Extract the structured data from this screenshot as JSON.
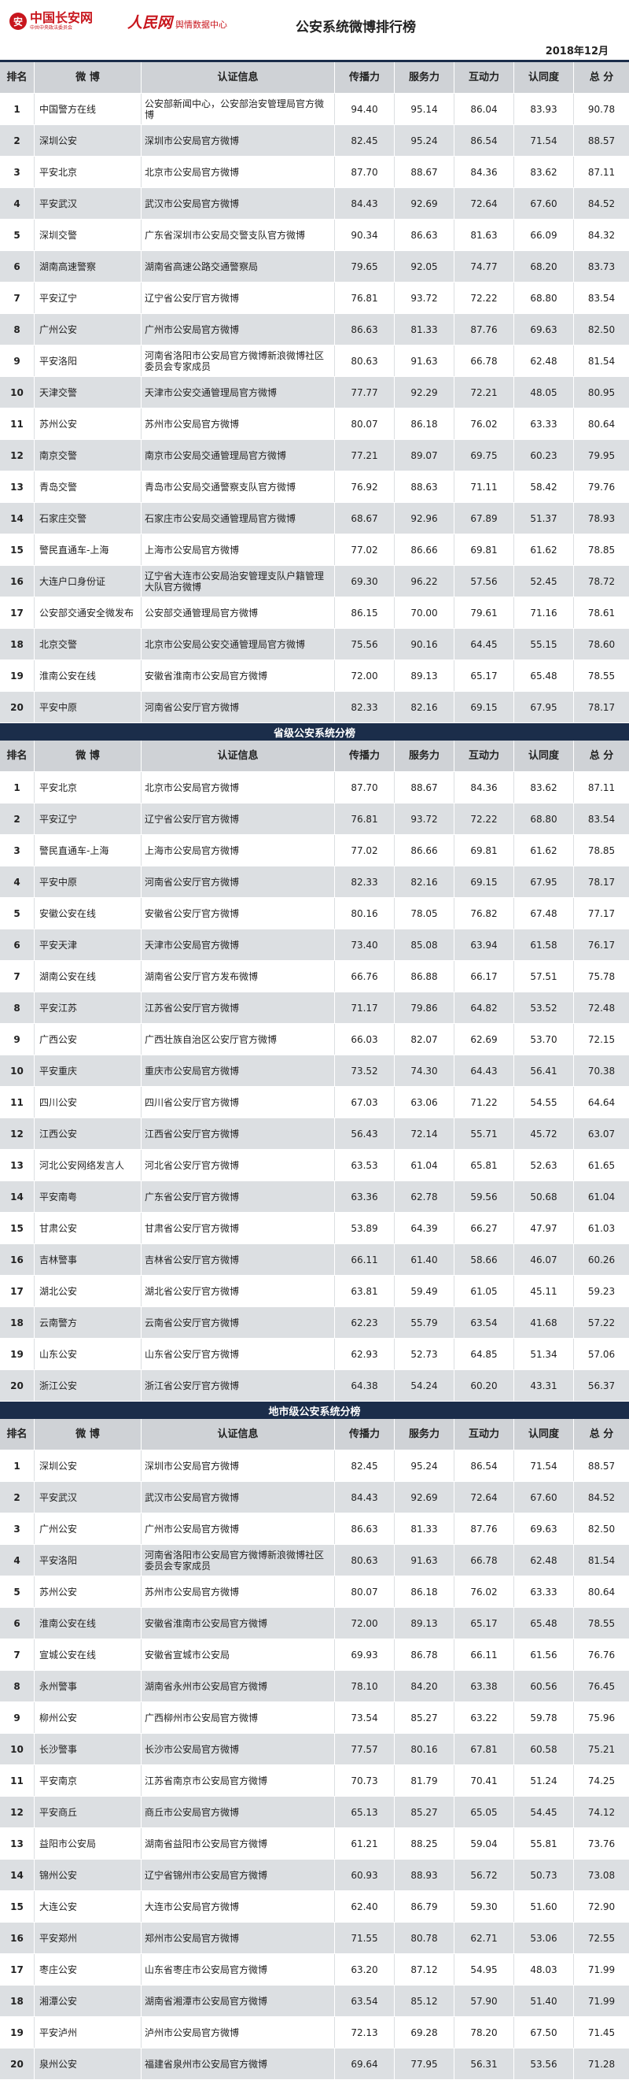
{
  "logos": {
    "site_name": "中国长安网",
    "site_sub": "中共中央政法委员会",
    "brand": "人民网",
    "brand_center": "舆情数据中心"
  },
  "title": "公安系统微博排行榜",
  "date": "2018年12月",
  "columns": [
    "排名",
    "微 博",
    "认证信息",
    "传播力",
    "服务力",
    "互动力",
    "认同度",
    "总 分"
  ],
  "sections": [
    {
      "title": "",
      "rows": [
        [
          "1",
          "中国警方在线",
          "公安部新闻中心，公安部治安管理局官方微博",
          "94.40",
          "95.14",
          "86.04",
          "83.93",
          "90.78"
        ],
        [
          "2",
          "深圳公安",
          "深圳市公安局官方微博",
          "82.45",
          "95.24",
          "86.54",
          "71.54",
          "88.57"
        ],
        [
          "3",
          "平安北京",
          "北京市公安局官方微博",
          "87.70",
          "88.67",
          "84.36",
          "83.62",
          "87.11"
        ],
        [
          "4",
          "平安武汉",
          "武汉市公安局官方微博",
          "84.43",
          "92.69",
          "72.64",
          "67.60",
          "84.52"
        ],
        [
          "5",
          "深圳交警",
          "广东省深圳市公安局交警支队官方微博",
          "90.34",
          "86.63",
          "81.63",
          "66.09",
          "84.32"
        ],
        [
          "6",
          "湖南高速警察",
          "湖南省高速公路交通警察局",
          "79.65",
          "92.05",
          "74.77",
          "68.20",
          "83.73"
        ],
        [
          "7",
          "平安辽宁",
          "辽宁省公安厅官方微博",
          "76.81",
          "93.72",
          "72.22",
          "68.80",
          "83.54"
        ],
        [
          "8",
          "广州公安",
          "广州市公安局官方微博",
          "86.63",
          "81.33",
          "87.76",
          "69.63",
          "82.50"
        ],
        [
          "9",
          "平安洛阳",
          "河南省洛阳市公安局官方微博新浪微博社区委员会专家成员",
          "80.63",
          "91.63",
          "66.78",
          "62.48",
          "81.54"
        ],
        [
          "10",
          "天津交警",
          "天津市公安交通管理局官方微博",
          "77.77",
          "92.29",
          "72.21",
          "48.05",
          "80.95"
        ],
        [
          "11",
          "苏州公安",
          "苏州市公安局官方微博",
          "80.07",
          "86.18",
          "76.02",
          "63.33",
          "80.64"
        ],
        [
          "12",
          "南京交警",
          "南京市公安局交通管理局官方微博",
          "77.21",
          "89.07",
          "69.75",
          "60.23",
          "79.95"
        ],
        [
          "13",
          "青岛交警",
          "青岛市公安局交通警察支队官方微博",
          "76.92",
          "88.63",
          "71.11",
          "58.42",
          "79.76"
        ],
        [
          "14",
          "石家庄交警",
          "石家庄市公安局交通管理局官方微博",
          "68.67",
          "92.96",
          "67.89",
          "51.37",
          "78.93"
        ],
        [
          "15",
          "警民直通车-上海",
          "上海市公安局官方微博",
          "77.02",
          "86.66",
          "69.81",
          "61.62",
          "78.85"
        ],
        [
          "16",
          "大连户口身份证",
          "辽宁省大连市公安局治安管理支队户籍管理大队官方微博",
          "69.30",
          "96.22",
          "57.56",
          "52.45",
          "78.72"
        ],
        [
          "17",
          "公安部交通安全微发布",
          "公安部交通管理局官方微博",
          "86.15",
          "70.00",
          "79.61",
          "71.16",
          "78.61"
        ],
        [
          "18",
          "北京交警",
          "北京市公安局公安交通管理局官方微博",
          "75.56",
          "90.16",
          "64.45",
          "55.15",
          "78.60"
        ],
        [
          "19",
          "淮南公安在线",
          "安徽省淮南市公安局官方微博",
          "72.00",
          "89.13",
          "65.17",
          "65.48",
          "78.55"
        ],
        [
          "20",
          "平安中原",
          "河南省公安厅官方微博",
          "82.33",
          "82.16",
          "69.15",
          "67.95",
          "78.17"
        ]
      ]
    },
    {
      "title": "省级公安系统分榜",
      "rows": [
        [
          "1",
          "平安北京",
          "北京市公安局官方微博",
          "87.70",
          "88.67",
          "84.36",
          "83.62",
          "87.11"
        ],
        [
          "2",
          "平安辽宁",
          "辽宁省公安厅官方微博",
          "76.81",
          "93.72",
          "72.22",
          "68.80",
          "83.54"
        ],
        [
          "3",
          "警民直通车-上海",
          "上海市公安局官方微博",
          "77.02",
          "86.66",
          "69.81",
          "61.62",
          "78.85"
        ],
        [
          "4",
          "平安中原",
          "河南省公安厅官方微博",
          "82.33",
          "82.16",
          "69.15",
          "67.95",
          "78.17"
        ],
        [
          "5",
          "安徽公安在线",
          "安徽省公安厅官方微博",
          "80.16",
          "78.05",
          "76.82",
          "67.48",
          "77.17"
        ],
        [
          "6",
          "平安天津",
          "天津市公安局官方微博",
          "73.40",
          "85.08",
          "63.94",
          "61.58",
          "76.17"
        ],
        [
          "7",
          "湖南公安在线",
          "湖南省公安厅官方发布微博",
          "66.76",
          "86.88",
          "66.17",
          "57.51",
          "75.78"
        ],
        [
          "8",
          "平安江苏",
          "江苏省公安厅官方微博",
          "71.17",
          "79.86",
          "64.82",
          "53.52",
          "72.48"
        ],
        [
          "9",
          "广西公安",
          "广西壮族自治区公安厅官方微博",
          "66.03",
          "82.07",
          "62.69",
          "53.70",
          "72.15"
        ],
        [
          "10",
          "平安重庆",
          "重庆市公安局官方微博",
          "73.52",
          "74.30",
          "64.43",
          "56.41",
          "70.38"
        ],
        [
          "11",
          "四川公安",
          "四川省公安厅官方微博",
          "67.03",
          "63.06",
          "71.22",
          "54.55",
          "64.64"
        ],
        [
          "12",
          "江西公安",
          "江西省公安厅官方微博",
          "56.43",
          "72.14",
          "55.71",
          "45.72",
          "63.07"
        ],
        [
          "13",
          "河北公安网络发言人",
          "河北省公安厅官方微博",
          "63.53",
          "61.04",
          "65.81",
          "52.63",
          "61.65"
        ],
        [
          "14",
          "平安南粤",
          "广东省公安厅官方微博",
          "63.36",
          "62.78",
          "59.56",
          "50.68",
          "61.04"
        ],
        [
          "15",
          "甘肃公安",
          "甘肃省公安厅官方微博",
          "53.89",
          "64.39",
          "66.27",
          "47.97",
          "61.03"
        ],
        [
          "16",
          "吉林警事",
          "吉林省公安厅官方微博",
          "66.11",
          "61.40",
          "58.66",
          "46.07",
          "60.26"
        ],
        [
          "17",
          "湖北公安",
          "湖北省公安厅官方微博",
          "63.81",
          "59.49",
          "61.05",
          "45.11",
          "59.23"
        ],
        [
          "18",
          "云南警方",
          "云南省公安厅官方微博",
          "62.23",
          "55.79",
          "63.54",
          "41.68",
          "57.22"
        ],
        [
          "19",
          "山东公安",
          "山东省公安厅官方微博",
          "62.93",
          "52.73",
          "64.85",
          "51.34",
          "57.06"
        ],
        [
          "20",
          "浙江公安",
          "浙江省公安厅官方微博",
          "64.38",
          "54.24",
          "60.20",
          "43.31",
          "56.37"
        ]
      ]
    },
    {
      "title": "地市级公安系统分榜",
      "rows": [
        [
          "1",
          "深圳公安",
          "深圳市公安局官方微博",
          "82.45",
          "95.24",
          "86.54",
          "71.54",
          "88.57"
        ],
        [
          "2",
          "平安武汉",
          "武汉市公安局官方微博",
          "84.43",
          "92.69",
          "72.64",
          "67.60",
          "84.52"
        ],
        [
          "3",
          "广州公安",
          "广州市公安局官方微博",
          "86.63",
          "81.33",
          "87.76",
          "69.63",
          "82.50"
        ],
        [
          "4",
          "平安洛阳",
          "河南省洛阳市公安局官方微博新浪微博社区委员会专家成员",
          "80.63",
          "91.63",
          "66.78",
          "62.48",
          "81.54"
        ],
        [
          "5",
          "苏州公安",
          "苏州市公安局官方微博",
          "80.07",
          "86.18",
          "76.02",
          "63.33",
          "80.64"
        ],
        [
          "6",
          "淮南公安在线",
          "安徽省淮南市公安局官方微博",
          "72.00",
          "89.13",
          "65.17",
          "65.48",
          "78.55"
        ],
        [
          "7",
          "宣城公安在线",
          "安徽省宣城市公安局",
          "69.93",
          "86.78",
          "66.11",
          "61.56",
          "76.76"
        ],
        [
          "8",
          "永州警事",
          "湖南省永州市公安局官方微博",
          "78.10",
          "84.20",
          "63.38",
          "60.56",
          "76.45"
        ],
        [
          "9",
          "柳州公安",
          "广西柳州市公安局官方微博",
          "73.54",
          "85.27",
          "63.22",
          "59.78",
          "75.96"
        ],
        [
          "10",
          "长沙警事",
          "长沙市公安局官方微博",
          "77.57",
          "80.16",
          "67.81",
          "60.58",
          "75.21"
        ],
        [
          "11",
          "平安南京",
          "江苏省南京市公安局官方微博",
          "70.73",
          "81.79",
          "70.41",
          "51.24",
          "74.25"
        ],
        [
          "12",
          "平安商丘",
          "商丘市公安局官方微博",
          "65.13",
          "85.27",
          "65.05",
          "54.45",
          "74.12"
        ],
        [
          "13",
          "益阳市公安局",
          "湖南省益阳市公安局官方微博",
          "61.21",
          "88.25",
          "59.04",
          "55.81",
          "73.76"
        ],
        [
          "14",
          "锦州公安",
          "辽宁省锦州市公安局官方微博",
          "60.93",
          "88.93",
          "56.72",
          "50.73",
          "73.08"
        ],
        [
          "15",
          "大连公安",
          "大连市公安局官方微博",
          "62.40",
          "86.79",
          "59.30",
          "51.60",
          "72.90"
        ],
        [
          "16",
          "平安郑州",
          "郑州市公安局官方微博",
          "71.55",
          "80.78",
          "62.71",
          "53.06",
          "72.55"
        ],
        [
          "17",
          "枣庄公安",
          "山东省枣庄市公安局官方微博",
          "63.20",
          "87.12",
          "54.95",
          "48.03",
          "71.99"
        ],
        [
          "18",
          "湘潭公安",
          "湖南省湘潭市公安局官方微博",
          "63.54",
          "85.12",
          "57.90",
          "51.40",
          "71.99"
        ],
        [
          "19",
          "平安泸州",
          "泸州市公安局官方微博",
          "72.13",
          "69.28",
          "78.20",
          "67.50",
          "71.45"
        ],
        [
          "20",
          "泉州公安",
          "福建省泉州市公安局官方微博",
          "69.64",
          "77.95",
          "56.31",
          "53.56",
          "71.28"
        ]
      ]
    }
  ]
}
